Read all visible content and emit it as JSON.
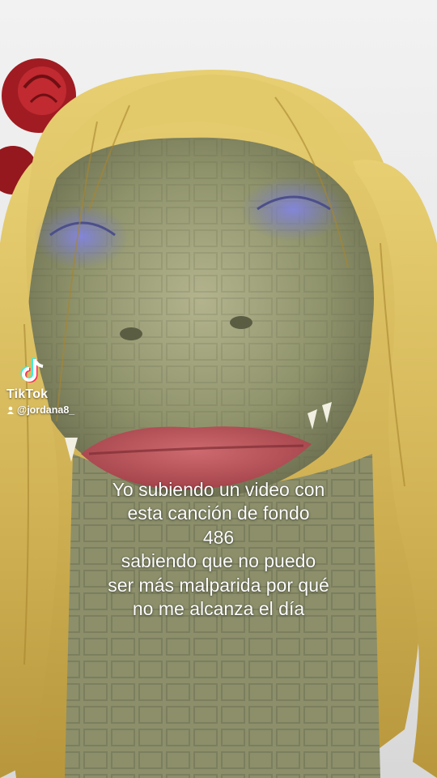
{
  "watermark": {
    "brand": "TikTok",
    "username": "@jordana8_",
    "logo_icon": "tiktok-logo-icon",
    "user_icon": "person-icon"
  },
  "caption": {
    "lines": [
      "Yo subiendo un video con",
      "esta canción de fondo",
      "486",
      "sabiendo que no puedo",
      "ser más malparida por qué",
      "no me alcanza el día"
    ]
  },
  "colors": {
    "caption_text": "#ffffff",
    "wig_blonde": "#d8bc5c",
    "skin_green": "#8e9468",
    "eyeshadow": "#6f74c8",
    "lips": "#b94f55",
    "rose": "#a01c22"
  }
}
